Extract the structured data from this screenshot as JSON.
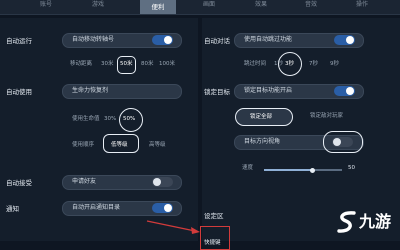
{
  "tabs": [
    "账号",
    "游戏",
    "便利",
    "画面",
    "效果",
    "音效",
    "操作"
  ],
  "active_tab_index": 2,
  "left": {
    "auto_run": {
      "label": "自动运行",
      "pill": "自动移动转轴号",
      "toggle_on": true,
      "distance_label": "移动距离",
      "distance_options": [
        "30米",
        "50米",
        "80米",
        "100米"
      ],
      "distance_selected_index": 1
    },
    "auto_use": {
      "label": "自动使用",
      "pill": "生命力恢复剂",
      "hp_label": "使用生命值",
      "hp_values": [
        "30%",
        "50%"
      ],
      "hp_selected_index": 1,
      "order_label": "使用顺序",
      "order_options": [
        "低等级",
        "高等级"
      ],
      "order_selected_index": 0
    },
    "auto_accept": {
      "label": "自动接受",
      "pill": "申请好友",
      "toggle_on": false
    },
    "notify": {
      "label": "通知",
      "pill": "自动开启通知目录",
      "toggle_on": true
    }
  },
  "right": {
    "auto_dialog": {
      "label": "自动对话",
      "pill": "使用自动跳过功能",
      "toggle_on": true,
      "skip_label": "跳过时间",
      "skip_options": [
        "1秒",
        "3秒",
        "7秒",
        "9秒"
      ],
      "skip_selected_index": 1
    },
    "lock_target": {
      "label": "锁定目标",
      "pill": "锁定目标功能开启",
      "toggle_on": true,
      "options": [
        "锁定全部",
        "锁定敌对玩家"
      ],
      "selected_index": 0,
      "direction_pill": "目标方向视角",
      "direction_toggle_on": false,
      "speed_label": "速度",
      "speed_value": "50",
      "speed_fraction": 0.62
    },
    "set_label": "设定区",
    "quick_label": "快捷键"
  },
  "watermark": "九游"
}
